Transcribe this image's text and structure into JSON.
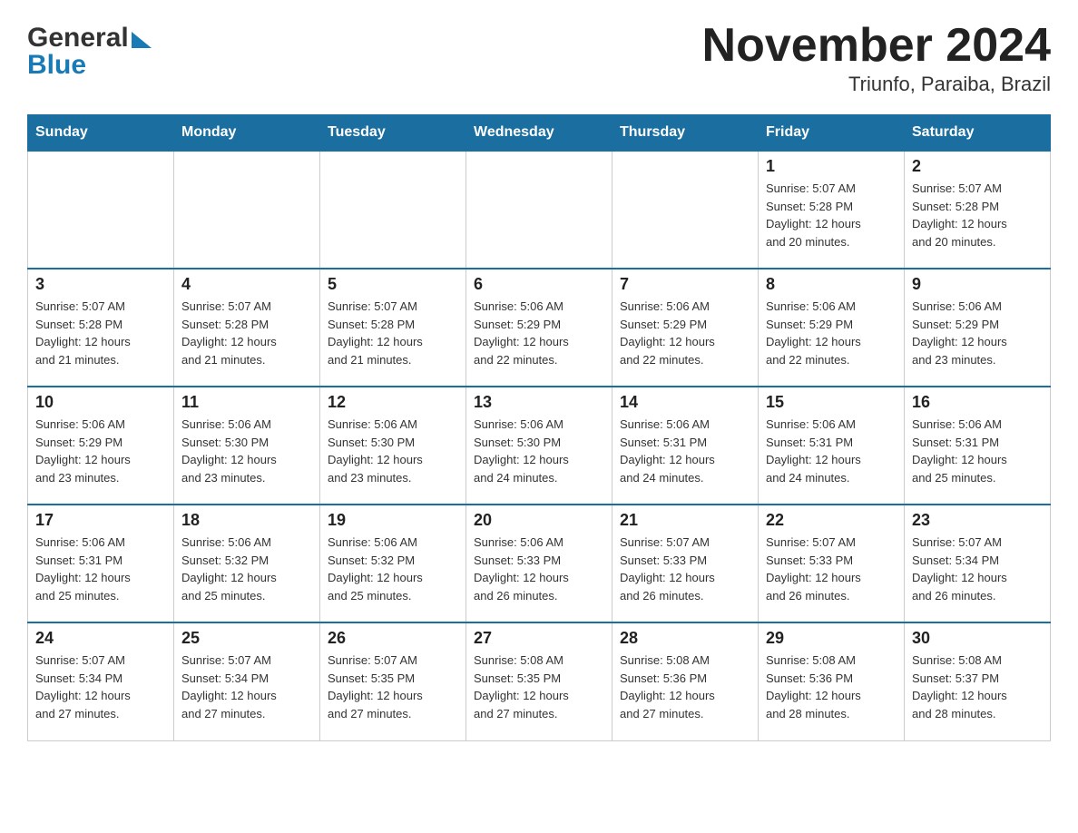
{
  "header": {
    "logo_general": "General",
    "logo_blue": "Blue",
    "title": "November 2024",
    "subtitle": "Triunfo, Paraiba, Brazil"
  },
  "days_of_week": [
    "Sunday",
    "Monday",
    "Tuesday",
    "Wednesday",
    "Thursday",
    "Friday",
    "Saturday"
  ],
  "weeks": [
    {
      "days": [
        {
          "number": "",
          "info": ""
        },
        {
          "number": "",
          "info": ""
        },
        {
          "number": "",
          "info": ""
        },
        {
          "number": "",
          "info": ""
        },
        {
          "number": "",
          "info": ""
        },
        {
          "number": "1",
          "info": "Sunrise: 5:07 AM\nSunset: 5:28 PM\nDaylight: 12 hours\nand 20 minutes."
        },
        {
          "number": "2",
          "info": "Sunrise: 5:07 AM\nSunset: 5:28 PM\nDaylight: 12 hours\nand 20 minutes."
        }
      ]
    },
    {
      "days": [
        {
          "number": "3",
          "info": "Sunrise: 5:07 AM\nSunset: 5:28 PM\nDaylight: 12 hours\nand 21 minutes."
        },
        {
          "number": "4",
          "info": "Sunrise: 5:07 AM\nSunset: 5:28 PM\nDaylight: 12 hours\nand 21 minutes."
        },
        {
          "number": "5",
          "info": "Sunrise: 5:07 AM\nSunset: 5:28 PM\nDaylight: 12 hours\nand 21 minutes."
        },
        {
          "number": "6",
          "info": "Sunrise: 5:06 AM\nSunset: 5:29 PM\nDaylight: 12 hours\nand 22 minutes."
        },
        {
          "number": "7",
          "info": "Sunrise: 5:06 AM\nSunset: 5:29 PM\nDaylight: 12 hours\nand 22 minutes."
        },
        {
          "number": "8",
          "info": "Sunrise: 5:06 AM\nSunset: 5:29 PM\nDaylight: 12 hours\nand 22 minutes."
        },
        {
          "number": "9",
          "info": "Sunrise: 5:06 AM\nSunset: 5:29 PM\nDaylight: 12 hours\nand 23 minutes."
        }
      ]
    },
    {
      "days": [
        {
          "number": "10",
          "info": "Sunrise: 5:06 AM\nSunset: 5:29 PM\nDaylight: 12 hours\nand 23 minutes."
        },
        {
          "number": "11",
          "info": "Sunrise: 5:06 AM\nSunset: 5:30 PM\nDaylight: 12 hours\nand 23 minutes."
        },
        {
          "number": "12",
          "info": "Sunrise: 5:06 AM\nSunset: 5:30 PM\nDaylight: 12 hours\nand 23 minutes."
        },
        {
          "number": "13",
          "info": "Sunrise: 5:06 AM\nSunset: 5:30 PM\nDaylight: 12 hours\nand 24 minutes."
        },
        {
          "number": "14",
          "info": "Sunrise: 5:06 AM\nSunset: 5:31 PM\nDaylight: 12 hours\nand 24 minutes."
        },
        {
          "number": "15",
          "info": "Sunrise: 5:06 AM\nSunset: 5:31 PM\nDaylight: 12 hours\nand 24 minutes."
        },
        {
          "number": "16",
          "info": "Sunrise: 5:06 AM\nSunset: 5:31 PM\nDaylight: 12 hours\nand 25 minutes."
        }
      ]
    },
    {
      "days": [
        {
          "number": "17",
          "info": "Sunrise: 5:06 AM\nSunset: 5:31 PM\nDaylight: 12 hours\nand 25 minutes."
        },
        {
          "number": "18",
          "info": "Sunrise: 5:06 AM\nSunset: 5:32 PM\nDaylight: 12 hours\nand 25 minutes."
        },
        {
          "number": "19",
          "info": "Sunrise: 5:06 AM\nSunset: 5:32 PM\nDaylight: 12 hours\nand 25 minutes."
        },
        {
          "number": "20",
          "info": "Sunrise: 5:06 AM\nSunset: 5:33 PM\nDaylight: 12 hours\nand 26 minutes."
        },
        {
          "number": "21",
          "info": "Sunrise: 5:07 AM\nSunset: 5:33 PM\nDaylight: 12 hours\nand 26 minutes."
        },
        {
          "number": "22",
          "info": "Sunrise: 5:07 AM\nSunset: 5:33 PM\nDaylight: 12 hours\nand 26 minutes."
        },
        {
          "number": "23",
          "info": "Sunrise: 5:07 AM\nSunset: 5:34 PM\nDaylight: 12 hours\nand 26 minutes."
        }
      ]
    },
    {
      "days": [
        {
          "number": "24",
          "info": "Sunrise: 5:07 AM\nSunset: 5:34 PM\nDaylight: 12 hours\nand 27 minutes."
        },
        {
          "number": "25",
          "info": "Sunrise: 5:07 AM\nSunset: 5:34 PM\nDaylight: 12 hours\nand 27 minutes."
        },
        {
          "number": "26",
          "info": "Sunrise: 5:07 AM\nSunset: 5:35 PM\nDaylight: 12 hours\nand 27 minutes."
        },
        {
          "number": "27",
          "info": "Sunrise: 5:08 AM\nSunset: 5:35 PM\nDaylight: 12 hours\nand 27 minutes."
        },
        {
          "number": "28",
          "info": "Sunrise: 5:08 AM\nSunset: 5:36 PM\nDaylight: 12 hours\nand 27 minutes."
        },
        {
          "number": "29",
          "info": "Sunrise: 5:08 AM\nSunset: 5:36 PM\nDaylight: 12 hours\nand 28 minutes."
        },
        {
          "number": "30",
          "info": "Sunrise: 5:08 AM\nSunset: 5:37 PM\nDaylight: 12 hours\nand 28 minutes."
        }
      ]
    }
  ]
}
